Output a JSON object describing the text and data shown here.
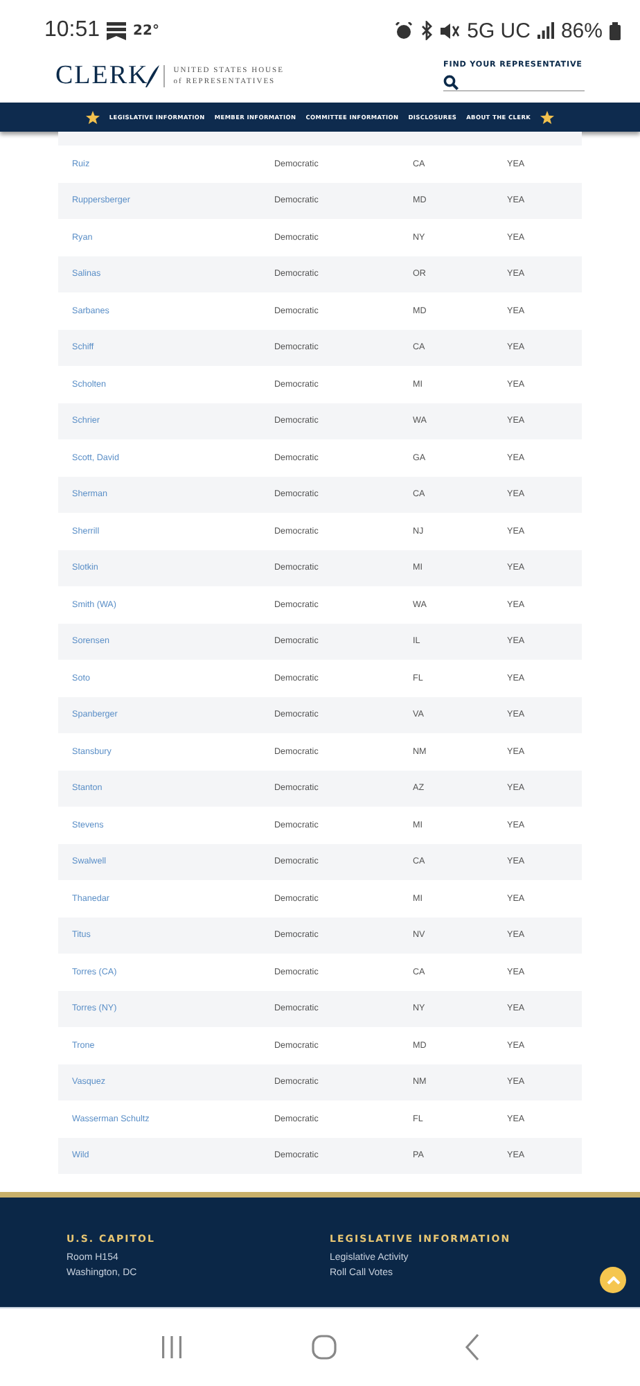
{
  "status_bar": {
    "time": "10:51",
    "temperature": "22°",
    "network": "5G UC",
    "battery": "86%"
  },
  "header": {
    "logo_text": "CLERK",
    "logo_line_1": "UNITED STATES HOUSE",
    "logo_line_2": "of REPRESENTATIVES",
    "find_label": "FIND YOUR REPRESENTATIVE"
  },
  "nav": {
    "items": [
      "LEGISLATIVE INFORMATION",
      "MEMBER INFORMATION",
      "COMMITTEE INFORMATION",
      "DISCLOSURES",
      "ABOUT THE CLERK"
    ]
  },
  "table": {
    "rows": [
      {
        "name": "Ruiz",
        "party": "Democratic",
        "state": "CA",
        "vote": "YEA"
      },
      {
        "name": "Ruppersberger",
        "party": "Democratic",
        "state": "MD",
        "vote": "YEA"
      },
      {
        "name": "Ryan",
        "party": "Democratic",
        "state": "NY",
        "vote": "YEA"
      },
      {
        "name": "Salinas",
        "party": "Democratic",
        "state": "OR",
        "vote": "YEA"
      },
      {
        "name": "Sarbanes",
        "party": "Democratic",
        "state": "MD",
        "vote": "YEA"
      },
      {
        "name": "Schiff",
        "party": "Democratic",
        "state": "CA",
        "vote": "YEA"
      },
      {
        "name": "Scholten",
        "party": "Democratic",
        "state": "MI",
        "vote": "YEA"
      },
      {
        "name": "Schrier",
        "party": "Democratic",
        "state": "WA",
        "vote": "YEA"
      },
      {
        "name": "Scott, David",
        "party": "Democratic",
        "state": "GA",
        "vote": "YEA"
      },
      {
        "name": "Sherman",
        "party": "Democratic",
        "state": "CA",
        "vote": "YEA"
      },
      {
        "name": "Sherrill",
        "party": "Democratic",
        "state": "NJ",
        "vote": "YEA"
      },
      {
        "name": "Slotkin",
        "party": "Democratic",
        "state": "MI",
        "vote": "YEA"
      },
      {
        "name": "Smith (WA)",
        "party": "Democratic",
        "state": "WA",
        "vote": "YEA"
      },
      {
        "name": "Sorensen",
        "party": "Democratic",
        "state": "IL",
        "vote": "YEA"
      },
      {
        "name": "Soto",
        "party": "Democratic",
        "state": "FL",
        "vote": "YEA"
      },
      {
        "name": "Spanberger",
        "party": "Democratic",
        "state": "VA",
        "vote": "YEA"
      },
      {
        "name": "Stansbury",
        "party": "Democratic",
        "state": "NM",
        "vote": "YEA"
      },
      {
        "name": "Stanton",
        "party": "Democratic",
        "state": "AZ",
        "vote": "YEA"
      },
      {
        "name": "Stevens",
        "party": "Democratic",
        "state": "MI",
        "vote": "YEA"
      },
      {
        "name": "Swalwell",
        "party": "Democratic",
        "state": "CA",
        "vote": "YEA"
      },
      {
        "name": "Thanedar",
        "party": "Democratic",
        "state": "MI",
        "vote": "YEA"
      },
      {
        "name": "Titus",
        "party": "Democratic",
        "state": "NV",
        "vote": "YEA"
      },
      {
        "name": "Torres (CA)",
        "party": "Democratic",
        "state": "CA",
        "vote": "YEA"
      },
      {
        "name": "Torres (NY)",
        "party": "Democratic",
        "state": "NY",
        "vote": "YEA"
      },
      {
        "name": "Trone",
        "party": "Democratic",
        "state": "MD",
        "vote": "YEA"
      },
      {
        "name": "Vasquez",
        "party": "Democratic",
        "state": "NM",
        "vote": "YEA"
      },
      {
        "name": "Wasserman Schultz",
        "party": "Democratic",
        "state": "FL",
        "vote": "YEA"
      },
      {
        "name": "Wild",
        "party": "Democratic",
        "state": "PA",
        "vote": "YEA"
      }
    ]
  },
  "footer": {
    "columns": [
      {
        "heading": "U.S. CAPITOL",
        "lines": [
          "Room H154",
          "Washington, DC"
        ]
      },
      {
        "heading": "LEGISLATIVE INFORMATION",
        "lines": [
          "Legislative Activity",
          "Roll Call Votes"
        ]
      }
    ]
  }
}
